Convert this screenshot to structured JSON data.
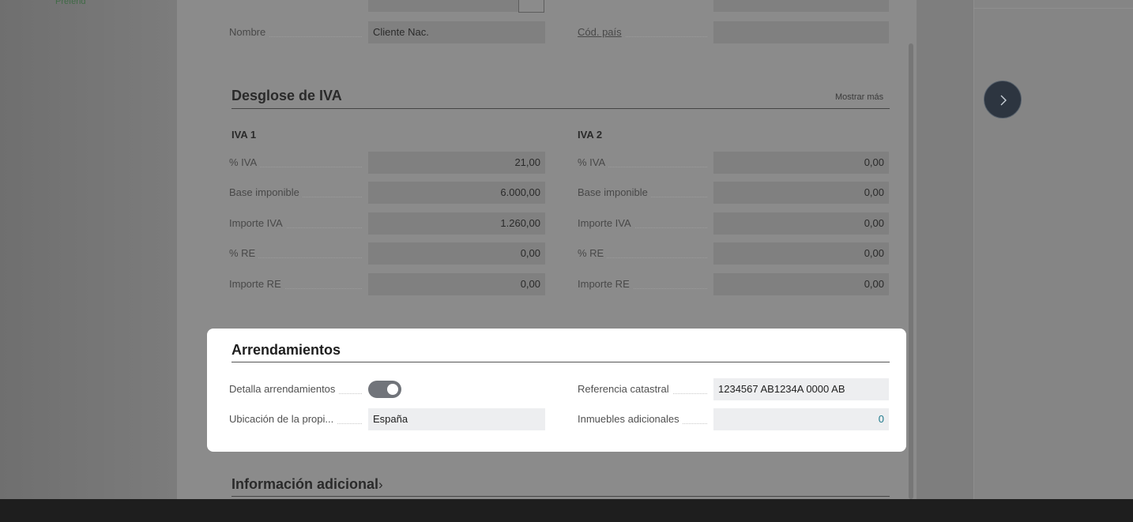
{
  "backdrop": {
    "left_partial_text": "Preferid"
  },
  "header_fields": {
    "nombre_label": "Nombre",
    "nombre_value": "Cliente Nac.",
    "cod_pais_label": "Cód. país",
    "cod_pais_value": ""
  },
  "vat": {
    "title": "Desglose de IVA",
    "show_more": "Mostrar más",
    "col1": {
      "title": "IVA 1",
      "rows": [
        {
          "label": "% IVA",
          "value": "21,00"
        },
        {
          "label": "Base imponible",
          "value": "6.000,00"
        },
        {
          "label": "Importe IVA",
          "value": "1.260,00"
        },
        {
          "label": "% RE",
          "value": "0,00"
        },
        {
          "label": "Importe RE",
          "value": "0,00"
        }
      ]
    },
    "col2": {
      "title": "IVA 2",
      "rows": [
        {
          "label": "% IVA",
          "value": "0,00"
        },
        {
          "label": "Base imponible",
          "value": "0,00"
        },
        {
          "label": "Importe IVA",
          "value": "0,00"
        },
        {
          "label": "% RE",
          "value": "0,00"
        },
        {
          "label": "Importe RE",
          "value": "0,00"
        }
      ]
    }
  },
  "leases": {
    "title": "Arrendamientos",
    "detalla_label": "Detalla arrendamientos",
    "detalla_on": true,
    "ubicacion_label": "Ubicación de la propi...",
    "ubicacion_value": "España",
    "referencia_label": "Referencia catastral",
    "referencia_value": "1234567 AB1234A 0000 AB",
    "inmuebles_label": "Inmuebles adicionales",
    "inmuebles_value": "0"
  },
  "additional": {
    "title": "Información adicional"
  },
  "colors": {
    "accent_link": "#1f7a8c",
    "toggle_on": "#71747a",
    "overlay": "#8b8b8b"
  }
}
